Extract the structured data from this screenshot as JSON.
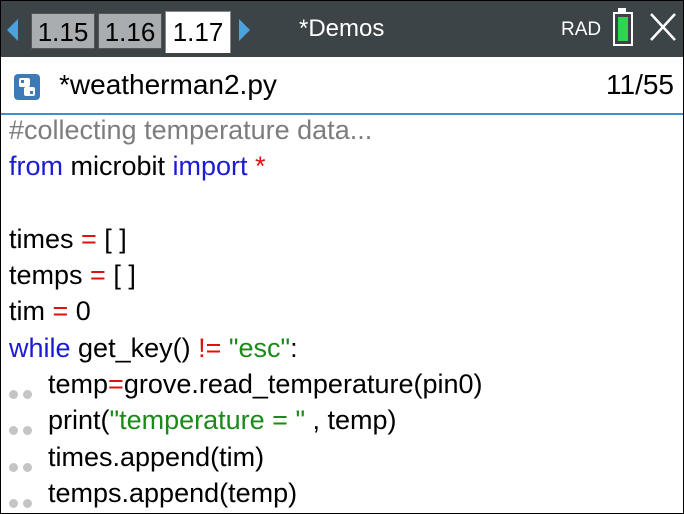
{
  "topbar": {
    "tabs": [
      {
        "label": "1.15"
      },
      {
        "label": "1.16"
      },
      {
        "label": "1.17"
      }
    ],
    "doc_title": "*Demos",
    "angle_mode": "RAD",
    "battery_color": "#2fd64a"
  },
  "file": {
    "name": "*weatherman2.py",
    "line_position": "11/55"
  },
  "code": {
    "l1": "#collecting temperature data...",
    "l2_kw1": "from",
    "l2_mod": " microbit ",
    "l2_kw2": "import",
    "l2_star": " *",
    "l4_a": "times ",
    "l4_eq": "=",
    "l4_b": " [ ]",
    "l5_a": "temps ",
    "l5_eq": "=",
    "l5_b": " [ ]",
    "l6_a": "tim ",
    "l6_eq": "=",
    "l6_b": " 0",
    "l7_kw": "while",
    "l7_a": " get_key() ",
    "l7_op": "!=",
    "l7_sp": " ",
    "l7_str": "\"esc\"",
    "l7_end": ":",
    "l8_a": "temp",
    "l8_eq": "=",
    "l8_b": "grove.read_temperature(pin0)",
    "l9_a": "print(",
    "l9_str": "\"temperature = \"",
    "l9_b": " , temp)",
    "l10": "times.append(tim)",
    "l11": "temps.append(temp)"
  }
}
